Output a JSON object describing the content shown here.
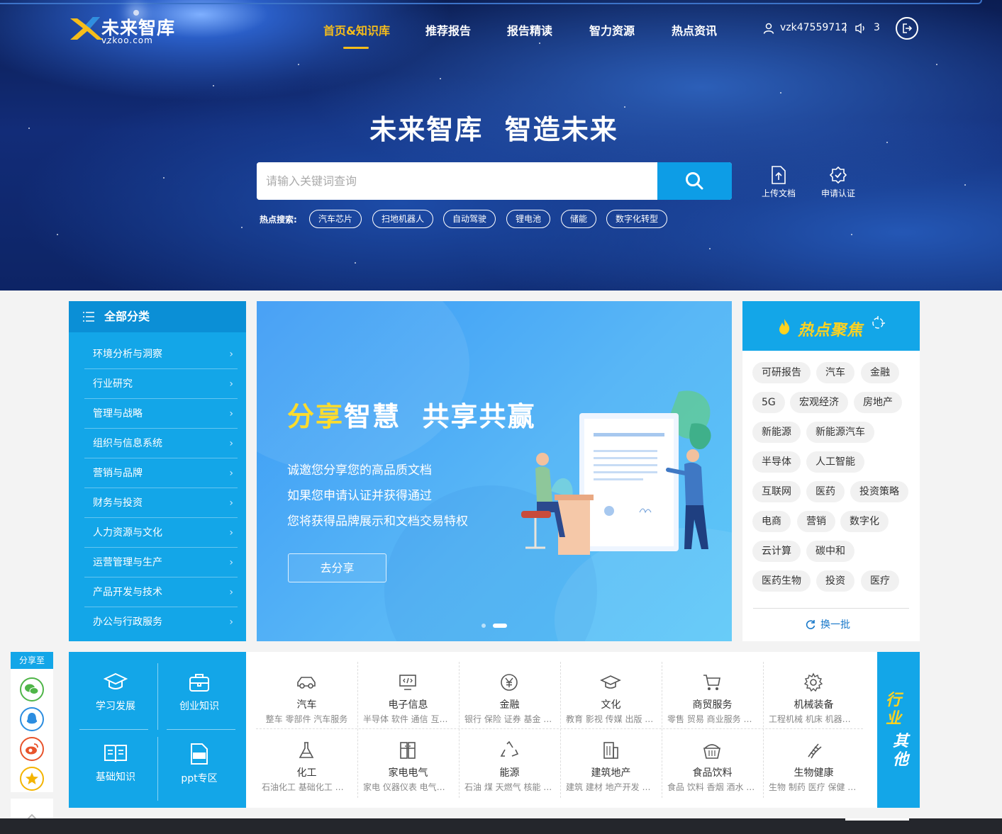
{
  "logo": {
    "name": "未来智库",
    "url": "vzkoo.com"
  },
  "nav": {
    "items": [
      {
        "label": "首页&知识库",
        "active": true
      },
      {
        "label": "推荐报告",
        "active": false
      },
      {
        "label": "报告精读",
        "active": false
      },
      {
        "label": "智力资源",
        "active": false
      },
      {
        "label": "热点资讯",
        "active": false
      }
    ]
  },
  "user": {
    "username": "vzk47559712",
    "separator": "|",
    "notifications": "3",
    "user_icon": "user-icon",
    "speaker_icon": "speaker-icon",
    "logout_icon": "logout-icon"
  },
  "hero": {
    "slogan": "未来智库  智造未来"
  },
  "search": {
    "placeholder": "请输入关键词查询",
    "value": "",
    "button_icon": "search-icon"
  },
  "tools": [
    {
      "label": "上传文档",
      "icon": "upload-document-icon"
    },
    {
      "label": "申请认证",
      "icon": "verified-badge-icon"
    }
  ],
  "hot_search": {
    "label": "热点搜索:",
    "tags": [
      "汽车芯片",
      "扫地机器人",
      "自动驾驶",
      "锂电池",
      "储能",
      "数字化转型"
    ]
  },
  "categories": {
    "title": "全部分类",
    "items": [
      "环境分析与洞察",
      "行业研究",
      "管理与战略",
      "组织与信息系统",
      "营销与品牌",
      "财务与投资",
      "人力资源与文化",
      "运营管理与生产",
      "产品开发与技术",
      "办公与行政服务"
    ]
  },
  "banner": {
    "title_highlight": "分享",
    "title_rest": "智慧  共享共赢",
    "lines": [
      "诚邀您分享您的高品质文档",
      "如果您申请认证并获得通过",
      "您将获得品牌展示和文档交易特权"
    ],
    "button": "去分享",
    "active_slide": 2,
    "slide_count": 2
  },
  "hot_focus": {
    "title": "热点聚焦",
    "tags": [
      "可研报告",
      "汽车",
      "金融",
      "5G",
      "宏观经济",
      "房地产",
      "新能源",
      "新能源汽车",
      "半导体",
      "人工智能",
      "互联网",
      "医药",
      "投资策略",
      "电商",
      "营销",
      "数字化",
      "云计算",
      "碳中和",
      "医药生物",
      "投资",
      "医疗"
    ],
    "refresh": "换一批"
  },
  "learn": [
    {
      "label": "学习发展",
      "icon": "graduation-cap-icon"
    },
    {
      "label": "创业知识",
      "icon": "briefcase-icon"
    },
    {
      "label": "基础知识",
      "icon": "open-book-icon"
    },
    {
      "label": "ppt专区",
      "icon": "ppt-file-icon"
    }
  ],
  "industries": [
    {
      "name": "汽车",
      "sub": "整车 零部件 汽车服务",
      "icon": "car-icon"
    },
    {
      "name": "电子信息",
      "sub": "半导体 软件 通信 互联网",
      "icon": "monitor-code-icon"
    },
    {
      "name": "金融",
      "sub": "银行 保险 证券 基金 信托",
      "icon": "yuan-coin-icon"
    },
    {
      "name": "文化",
      "sub": "教育 影视 传媒 出版 体育",
      "icon": "graduation-cap-icon"
    },
    {
      "name": "商贸服务",
      "sub": "零售 贸易 商业服务 物流",
      "icon": "shopping-cart-icon"
    },
    {
      "name": "机械装备",
      "sub": "工程机械 机床 机器人 仪器",
      "icon": "gear-icon"
    },
    {
      "name": "化工",
      "sub": "石油化工 基础化工 化纤",
      "icon": "flask-icon"
    },
    {
      "name": "家电电气",
      "sub": "家电 仪器仪表 电气设备",
      "icon": "fridge-icon"
    },
    {
      "name": "能源",
      "sub": "石油 煤 天燃气 核能 电力",
      "icon": "recycle-icon"
    },
    {
      "name": "建筑地产",
      "sub": "建筑 建材 地产开发 物业",
      "icon": "building-icon"
    },
    {
      "name": "食品饮料",
      "sub": "食品 饮料 香烟 酒水 餐饮",
      "icon": "food-basket-icon"
    },
    {
      "name": "生物健康",
      "sub": "生物 制药 医疗 保健 器械",
      "icon": "dna-icon"
    }
  ],
  "other": {
    "line1": "行业",
    "line2": "其他"
  },
  "share": {
    "title": "分享至",
    "targets": [
      "wechat-icon",
      "qq-icon",
      "weibo-icon",
      "qzone-icon"
    ],
    "colors": [
      "#4fb548",
      "#2c8de0",
      "#e8542c",
      "#f4b400"
    ]
  },
  "colors": {
    "accent": "#13a6e8",
    "highlight": "#f6bd1a",
    "banner_yellow": "#ffdc2c"
  }
}
